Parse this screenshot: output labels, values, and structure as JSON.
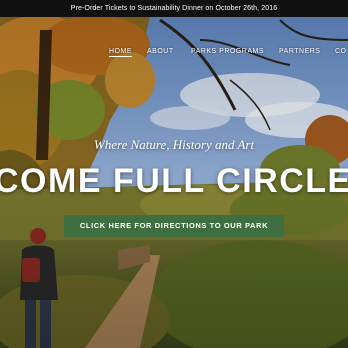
{
  "announcement": {
    "text": "Pre-Order Tickets to Sustainability Dinner on October 26th, 2016"
  },
  "nav": {
    "items": [
      {
        "label": "HOME",
        "active": true
      },
      {
        "label": "ABOUT",
        "active": false
      },
      {
        "label": "PARKS PROGRAMS",
        "active": false
      },
      {
        "label": "PARTNERS",
        "active": false
      },
      {
        "label": "CO",
        "active": false
      }
    ]
  },
  "hero": {
    "tagline": "Where Nature, History and Art",
    "headline": "COME FULL CIRCLE",
    "cta_label": "CLICK HERE FOR DIRECTIONS TO OUR PARK"
  },
  "colors": {
    "announce_bg": "#111111",
    "cta_bg": "#3f6f40",
    "text": "#ffffff"
  }
}
